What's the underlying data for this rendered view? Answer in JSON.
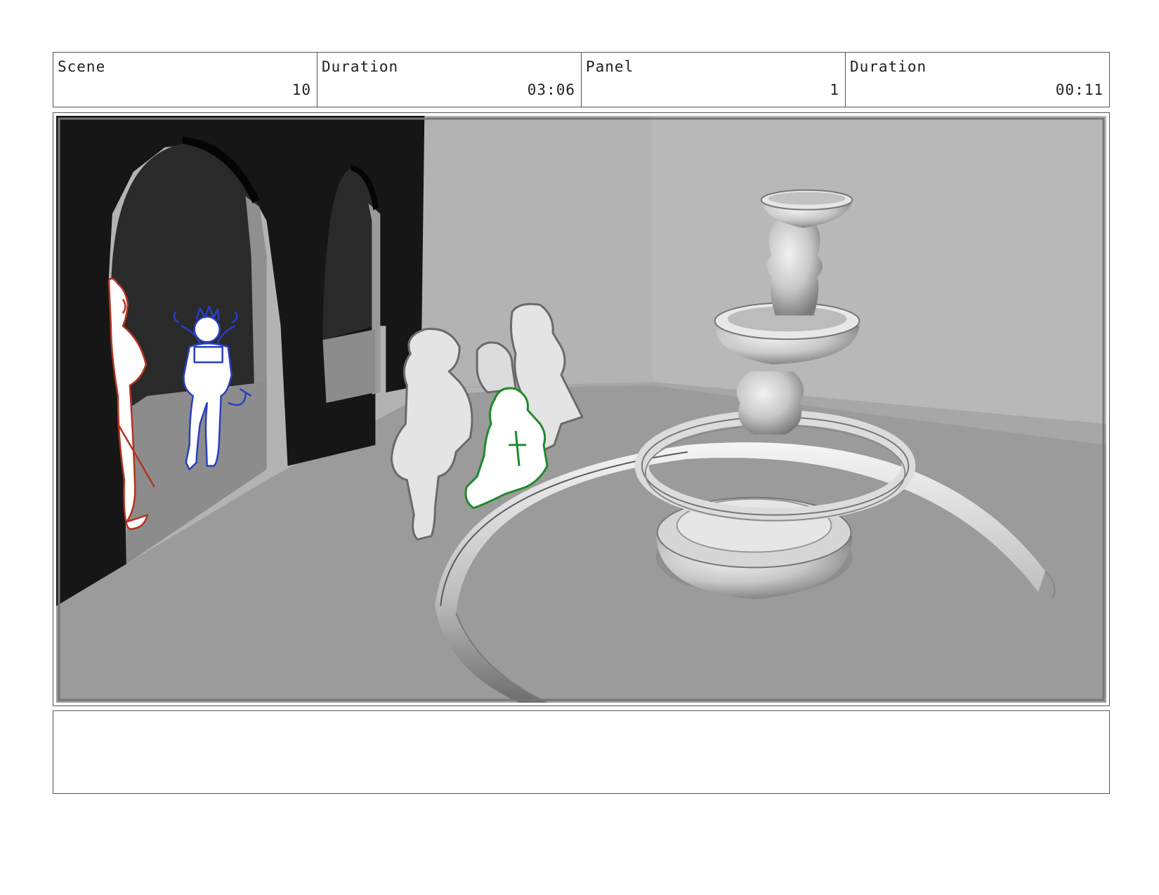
{
  "header": {
    "scene_label": "Scene",
    "scene_value": "10",
    "scene_duration_label": "Duration",
    "scene_duration_value": "03:06",
    "panel_label": "Panel",
    "panel_value": "1",
    "panel_duration_label": "Duration",
    "panel_duration_value": "00:11"
  },
  "panel": {
    "sketch_colors": {
      "red": "#b3341f",
      "blue": "#2a3fc0",
      "green": "#1f8a2a",
      "gray": "#6a6a6a"
    }
  },
  "notes": {
    "text": ""
  }
}
